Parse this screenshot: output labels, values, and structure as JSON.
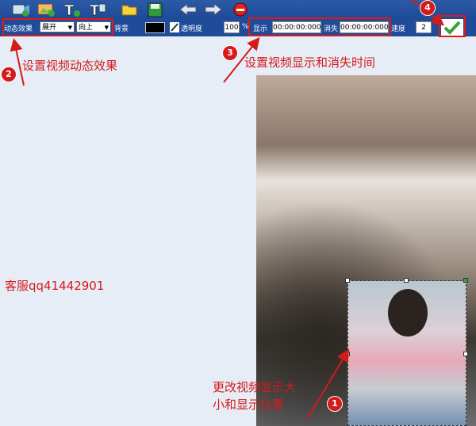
{
  "toolbar_top": {
    "icons": [
      "add-video-icon",
      "add-image-icon",
      "add-text-icon",
      "add-subtitle-icon",
      "open-folder-icon",
      "save-icon",
      "undo-icon",
      "redo-icon",
      "delete-icon"
    ]
  },
  "toolbar_bottom": {
    "effect_label": "动态效果",
    "effect_value": "展开",
    "direction_value": "向上",
    "background_label": "背景",
    "transparency_label": "透明度",
    "opacity_value": "100",
    "percent": "%",
    "show_label": "显示",
    "show_time": "00:00:00:000",
    "hide_label": "消失",
    "hide_time": "00:00:00:000",
    "speed_label": "速度",
    "speed_value": "2"
  },
  "annotations": {
    "a1_num": "1",
    "a1_text_line1": "更改视频显示大",
    "a1_text_line2": "小和显示位置",
    "a2_num": "2",
    "a2_text": "设置视频动态效果",
    "a3_num": "3",
    "a3_text": "设置视频显示和消失时间",
    "a4_num": "4",
    "contact": "客服qq41442901"
  },
  "colors": {
    "annotation": "#d51a1a",
    "toolbar": "#1f4c9a",
    "canvas": "#e6edf6"
  }
}
